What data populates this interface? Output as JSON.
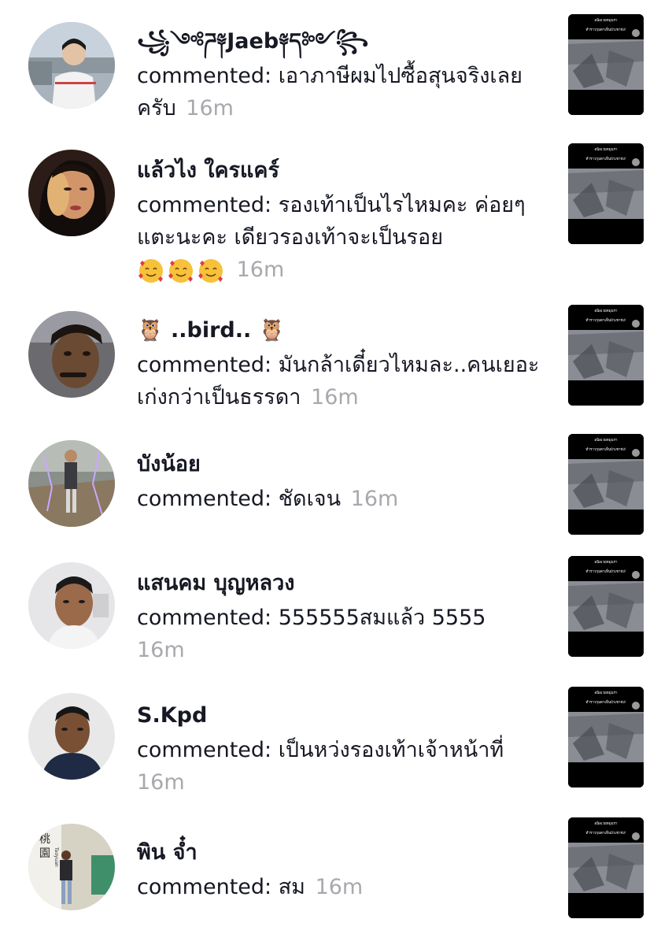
{
  "notifications": [
    {
      "name": "꧁༺ཌ༈Jaeb༈ད༻꧂",
      "comment": "commented: เอาภาษีผมไปซื้อสุนจริงเลยครับ",
      "time": "16m",
      "avatar_icon": "person-avatar",
      "thumb_caption_1": "อนิลเวยหมุนรา",
      "thumb_caption_2": "ทำราวกุมตาเห็นบัวเชาช่ง!"
    },
    {
      "name": "แล้วไง ใครแคร์",
      "comment": "commented: รองเท้าเป็นไรไหมคะ ค่อยๆแตะนะคะ เดียวรองเท้าจะเป็นรอย",
      "emoji_count": 3,
      "time": "16m",
      "avatar_icon": "person-avatar",
      "thumb_caption_1": "อนิลเวยหมุนรา",
      "thumb_caption_2": "ทำราวกุมตาเห็นบัวเชาช่ง!"
    },
    {
      "name": "🦉 ..bird.. 🦉",
      "comment": "commented: มันกล้าเดี๋ยวไหมละ..คนเยอะเก่งกว่าเป็นธรรดา",
      "time": "16m",
      "avatar_icon": "person-avatar",
      "thumb_caption_1": "อนิลเวยหมุนรา",
      "thumb_caption_2": "ทำราวกุมตาเห็นบัวเชาช่ง!"
    },
    {
      "name": "บังน้อย",
      "comment": "commented: ชัดเจน",
      "time": "16m",
      "avatar_icon": "person-avatar",
      "thumb_caption_1": "อนิลเวยหมุนรา",
      "thumb_caption_2": "ทำราวกุมตาเห็นบัวเชาช่ง!"
    },
    {
      "name": "แสนคม  บุญหลวง",
      "comment": "commented: 555555สมแล้ว 5555",
      "time": "16m",
      "avatar_icon": "person-avatar",
      "thumb_caption_1": "อนิลเวยหมุนรา",
      "thumb_caption_2": "ทำราวกุมตาเห็นบัวเชาช่ง!"
    },
    {
      "name": "S.Kpd",
      "comment": "commented: เป็นหว่งรองเท้าเจ้าหน้าที่",
      "time": "16m",
      "avatar_icon": "person-avatar",
      "thumb_caption_1": "อนิลเวยหมุนรา",
      "thumb_caption_2": "ทำราวกุมตาเห็นบัวเชาช่ง!"
    },
    {
      "name": "พิน จ๋ำ",
      "comment": "commented: สม",
      "time": "16m",
      "avatar_icon": "person-avatar",
      "avatar_text_1": "桃",
      "avatar_text_2": "園",
      "avatar_text_3": "Taoyuan",
      "thumb_caption_1": "อนิลเวยหมุนรา",
      "thumb_caption_2": "ทำราวกุมตาเห็นบัวเชาช่ง!"
    }
  ]
}
